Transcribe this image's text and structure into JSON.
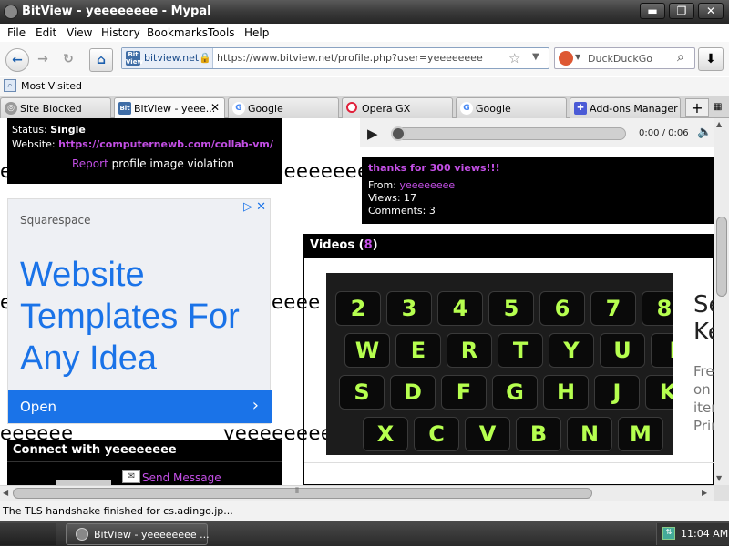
{
  "window": {
    "title": "BitView - yeeeeeeee - Mypal",
    "buttons": {
      "minimize": "▬",
      "maximize": "❐",
      "close": "✕"
    }
  },
  "menu": [
    "File",
    "Edit",
    "View",
    "History",
    "Bookmarks",
    "Tools",
    "Help"
  ],
  "nav": {
    "back": "←",
    "forward": "→",
    "reload": "↻",
    "home": "⌂",
    "identity_site": "bitview.net",
    "url": "https://www.bitview.net/profile.php?user=yeeeeeeee",
    "search_engine": "DuckDuckGo",
    "favicon_text": "Bit View"
  },
  "bookmarks": {
    "most_visited": "Most Visited"
  },
  "tabs": [
    {
      "label": "Site Blocked",
      "icon": "globe-icon",
      "color": "#777777"
    },
    {
      "label": "BitView - yeee...",
      "icon": "bitview-icon",
      "color": "#3f6da6",
      "active": true
    },
    {
      "label": "Google",
      "icon": "google-icon",
      "color": "#4285f4"
    },
    {
      "label": "Opera GX",
      "icon": "opera-icon",
      "color": "#e0203a"
    },
    {
      "label": "Google",
      "icon": "google-icon",
      "color": "#4285f4"
    },
    {
      "label": "Add-ons Manager",
      "icon": "puzzle-icon",
      "color": "#4b5bd6"
    }
  ],
  "profile": {
    "status_label": "Status:",
    "status_value": "Single",
    "website_label": "Website:",
    "website_value": "https://computernewb.com/collab-vm/",
    "report_link": "Report",
    "report_rest": "profile image violation"
  },
  "player": {
    "time": "0:00 / 0:06"
  },
  "video_info": {
    "title": "thanks for 300 views!!!",
    "from_label": "From:",
    "from_value": "yeeeeeeee",
    "views": "Views: 17",
    "comments": "Comments: 3"
  },
  "background_text": {
    "row1a": "eeeeeeee",
    "row1b": "yeeeeeeeeeee",
    "row1c": "yeeeeeeeeeeee",
    "row2a": "eeee",
    "row3a": "eeeeee",
    "row3b": "yeeeeeeee"
  },
  "ad": {
    "brand": "Squarespace",
    "headline": "Website Templates For Any Idea",
    "cta": "Open",
    "cta_arrow": "›",
    "icons": "▷ ✕"
  },
  "connect": {
    "title": "Connect with yeeeeeeee",
    "send_message": "Send Message"
  },
  "videos": {
    "header": "Videos",
    "count": "8",
    "side_heading_1": "Se",
    "side_heading_2": "Ke",
    "side_text": [
      "Fre",
      "on",
      "iter",
      "Prir"
    ],
    "keyboard_rows": [
      [
        "2",
        "3",
        "4",
        "5",
        "6",
        "7",
        "8"
      ],
      [
        "W",
        "E",
        "R",
        "T",
        "Y",
        "U",
        "I"
      ],
      [
        "S",
        "D",
        "F",
        "G",
        "H",
        "J",
        "K"
      ],
      [
        "X",
        "C",
        "V",
        "B",
        "N",
        "M"
      ]
    ]
  },
  "status_bar": "The TLS handshake finished for cs.adingo.jp...",
  "taskbar": {
    "window_button": "BitView - yeeeeeeee ...",
    "clock": "11:04 AM"
  }
}
